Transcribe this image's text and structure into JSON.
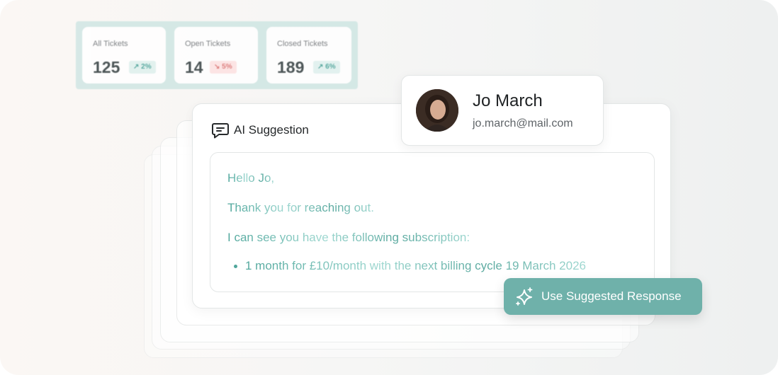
{
  "stats": [
    {
      "label": "All Tickets",
      "value": "125",
      "change": "2%",
      "trend": "up"
    },
    {
      "label": "Open Tickets",
      "value": "14",
      "change": "5%",
      "trend": "down"
    },
    {
      "label": "Closed Tickets",
      "value": "189",
      "change": "6%",
      "trend": "up"
    }
  ],
  "suggestion": {
    "title": "AI Suggestion",
    "greeting": "Hello Jo,",
    "thanks": "Thank you for reaching out.",
    "intro": "I can see you have the following subscription:",
    "bullet": "1 month for £10/month with the next billing cycle 19 March 2026"
  },
  "contact": {
    "name": "Jo March",
    "email": "jo.march@mail.com"
  },
  "action": {
    "label": "Use Suggested Response"
  },
  "colors": {
    "accent": "#6fb1aa",
    "teal_text": "#4fa69b",
    "up_badge": "#dff1ee",
    "down_badge": "#fde2e2"
  }
}
